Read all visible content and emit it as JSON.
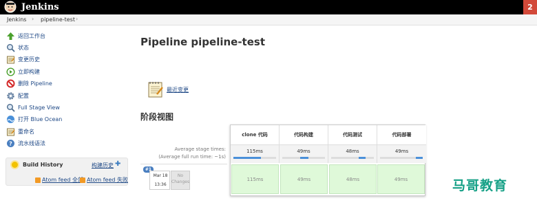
{
  "header": {
    "brand": "Jenkins",
    "badge": "2"
  },
  "breadcrumb": {
    "items": [
      "Jenkins",
      "pipeline-test"
    ]
  },
  "sidebar": {
    "items": [
      {
        "label": "返回工作台",
        "icon": "up-arrow-icon"
      },
      {
        "label": "状态",
        "icon": "search-icon"
      },
      {
        "label": "变更历史",
        "icon": "notepad-icon"
      },
      {
        "label": "立即构建",
        "icon": "clock-play-icon"
      },
      {
        "label": "删除 Pipeline",
        "icon": "no-entry-icon"
      },
      {
        "label": "配置",
        "icon": "gear-icon"
      },
      {
        "label": "Full Stage View",
        "icon": "search-icon"
      },
      {
        "label": "打开 Blue Ocean",
        "icon": "blue-ocean-icon"
      },
      {
        "label": "重命名",
        "icon": "notepad-icon"
      },
      {
        "label": "流水线语法",
        "icon": "help-icon"
      }
    ]
  },
  "build_history": {
    "title": "Build History",
    "trend_label": "构建历史",
    "feed_all": "Atom feed 全部",
    "feed_failed": "Atom feed 失败"
  },
  "main": {
    "title": "Pipeline pipeline-test",
    "recent_changes": "最近变更",
    "stage_heading": "阶段视图",
    "avg_stage_label": "Average stage times:",
    "avg_run_label": "(Average full run time: ~1s)"
  },
  "stages": [
    {
      "name": "clone 代码",
      "avg": "115ms",
      "value": "115ms"
    },
    {
      "name": "代码构建",
      "avg": "49ms",
      "value": "49ms"
    },
    {
      "name": "代码测试",
      "avg": "48ms",
      "value": "48ms"
    },
    {
      "name": "代码部署",
      "avg": "49ms",
      "value": "49ms"
    }
  ],
  "build": {
    "number": "#1",
    "date": "Mar 18",
    "time": "13:36",
    "no_changes": "No Changes"
  },
  "watermark": "马哥教育",
  "colors": {
    "header_bg": "#000000",
    "badge_bg": "#d24939",
    "link": "#204a87",
    "success_cell": "#dff9d9",
    "watermark": "#15a086"
  }
}
